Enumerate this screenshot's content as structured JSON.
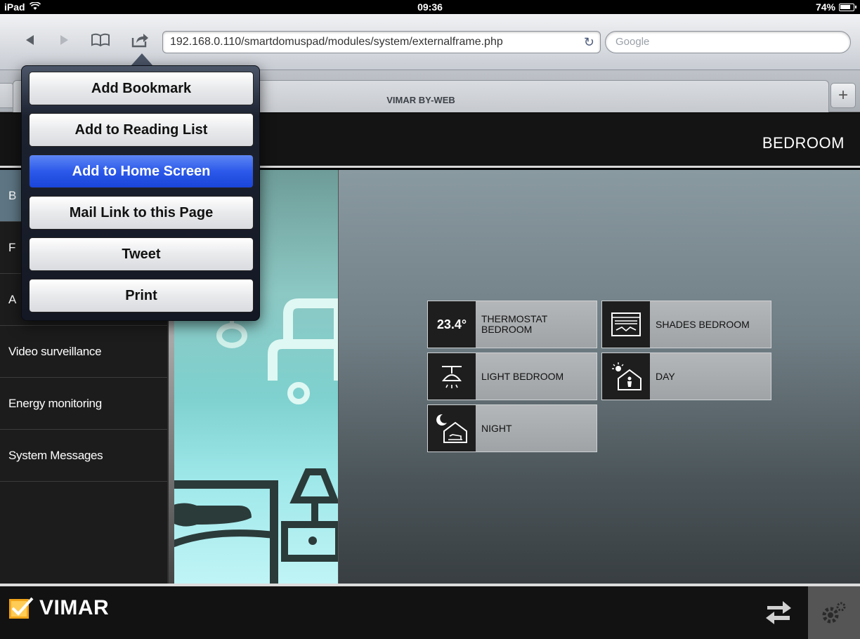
{
  "status_bar": {
    "device": "iPad",
    "time": "09:36",
    "battery": "74%"
  },
  "browser": {
    "url": "192.168.0.110/smartdomuspad/modules/system/externalframe.php",
    "search_placeholder": "Google",
    "tab_title": "VIMAR BY-WEB",
    "tab_add": "+"
  },
  "share_menu": {
    "items": [
      {
        "label": "Add Bookmark"
      },
      {
        "label": "Add to Reading List"
      },
      {
        "label": "Add to Home Screen"
      },
      {
        "label": "Mail Link to this Page"
      },
      {
        "label": "Tweet"
      },
      {
        "label": "Print"
      }
    ],
    "highlighted": "Add to Home Screen"
  },
  "app": {
    "room_title": "BEDROOM",
    "sidebar": {
      "items": [
        {
          "label": "B"
        },
        {
          "label": "F"
        },
        {
          "label": "A"
        },
        {
          "label": "Video surveillance"
        },
        {
          "label": "Energy monitoring"
        },
        {
          "label": "System Messages"
        }
      ],
      "active_index": 0
    },
    "tiles": [
      {
        "label": "THERMOSTAT BEDROOM",
        "value": "23.4°",
        "icon": "thermostat-icon"
      },
      {
        "label": "SHADES BEDROOM",
        "icon": "shades-icon"
      },
      {
        "label": "LIGHT BEDROOM",
        "icon": "ceiling-light-icon"
      },
      {
        "label": "DAY",
        "icon": "day-scenario-icon"
      },
      {
        "label": "NIGHT",
        "icon": "night-scenario-icon"
      }
    ],
    "brand": "VIMAR"
  }
}
